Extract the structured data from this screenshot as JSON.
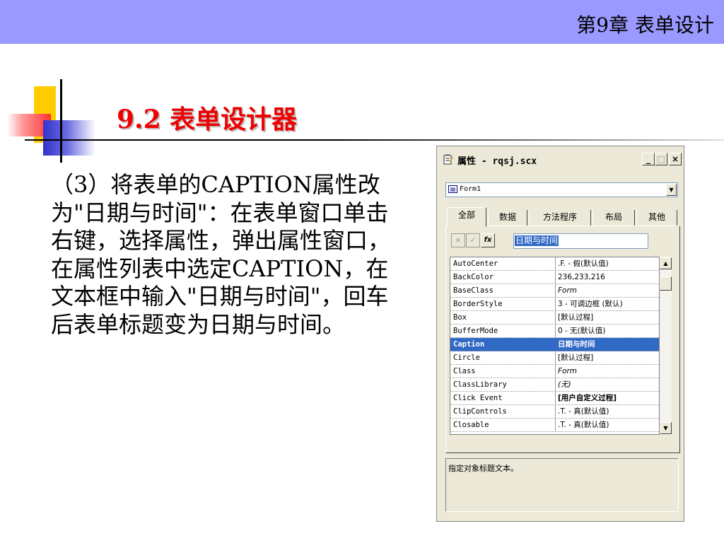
{
  "slide": {
    "chapter": "第9章  表单设计",
    "section_title": "9.2  表单设计器",
    "body": "（3）将表单的CAPTION属性改为\"日期与时间\"：在表单窗口单击右键，选择属性，弹出属性窗口，在属性列表中选定CAPTION，在文本框中输入\"日期与时间\"，回车后表单标题变为日期与时间。"
  },
  "window": {
    "title": "属性 - rqsj.scx",
    "icon": "properties-icon",
    "buttons": {
      "minimize": "_",
      "maximize": "□",
      "close": "×"
    },
    "object_combo": "Form1",
    "tabs": [
      "全部",
      "数据",
      "方法程序",
      "布局",
      "其他"
    ],
    "active_tab": "全部",
    "toolbar": {
      "cancel": "×",
      "accept": "✓",
      "function": "fx"
    },
    "value_input": "日期与时间",
    "properties": [
      {
        "name": "AutoCenter",
        "value": ".F. - 假(默认值)"
      },
      {
        "name": "BackColor",
        "value": "236,233,216"
      },
      {
        "name": "BaseClass",
        "value": "Form"
      },
      {
        "name": "BorderStyle",
        "value": "3 - 可调边框  (默认)"
      },
      {
        "name": "Box",
        "value": "[默认过程]"
      },
      {
        "name": "BufferMode",
        "value": "0 - 无(默认值)"
      },
      {
        "name": "Caption",
        "value": "日期与时间"
      },
      {
        "name": "Circle",
        "value": "[默认过程]"
      },
      {
        "name": "Class",
        "value": "Form"
      },
      {
        "name": "ClassLibrary",
        "value": "(无)"
      },
      {
        "name": "Click Event",
        "value": "[用户自定义过程]"
      },
      {
        "name": "ClipControls",
        "value": ".T. - 真(默认值)"
      },
      {
        "name": "Closable",
        "value": ".T. - 真(默认值)"
      }
    ],
    "selected_property": "Caption",
    "description": "指定对象标题文本。"
  },
  "colors": {
    "topbar": "#9999ff",
    "title_red": "#ee0000",
    "selection": "#316ac5",
    "window_bg": "#ece9d8"
  }
}
